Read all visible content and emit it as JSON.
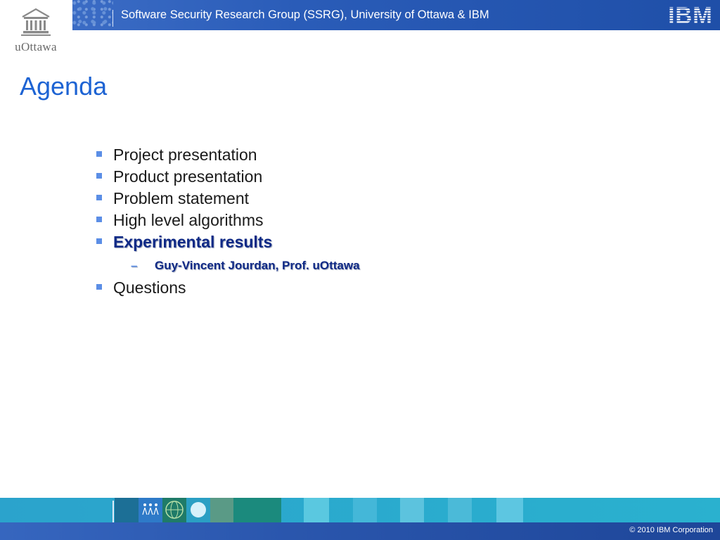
{
  "header": {
    "university_wordmark": "uOttawa",
    "title": "Software Security Research Group (SSRG), University of Ottawa & IBM",
    "brand_logo": "IBM"
  },
  "slide": {
    "title": "Agenda",
    "agenda": [
      {
        "label": "Project presentation"
      },
      {
        "label": "Product presentation"
      },
      {
        "label": "Problem statement"
      },
      {
        "label": "High level algorithms"
      },
      {
        "label": "Experimental results",
        "active": true,
        "sub_dash": "–",
        "sub": "Guy-Vincent Jourdan, Prof. uOttawa"
      },
      {
        "label": "Questions"
      }
    ]
  },
  "footer": {
    "copyright": "© 2010 IBM Corporation"
  },
  "icons": {
    "bullet": "square-bullet-icon",
    "university": "uottawa-building-emblem-icon",
    "brand": "ibm-striped-logo"
  },
  "colors": {
    "title_blue": "#1d63d3",
    "bullet_blue": "#5b8ee6",
    "active_item": "#102a86",
    "header_band": "#2a5cb8",
    "footer_strip": "#2ab1cf"
  }
}
